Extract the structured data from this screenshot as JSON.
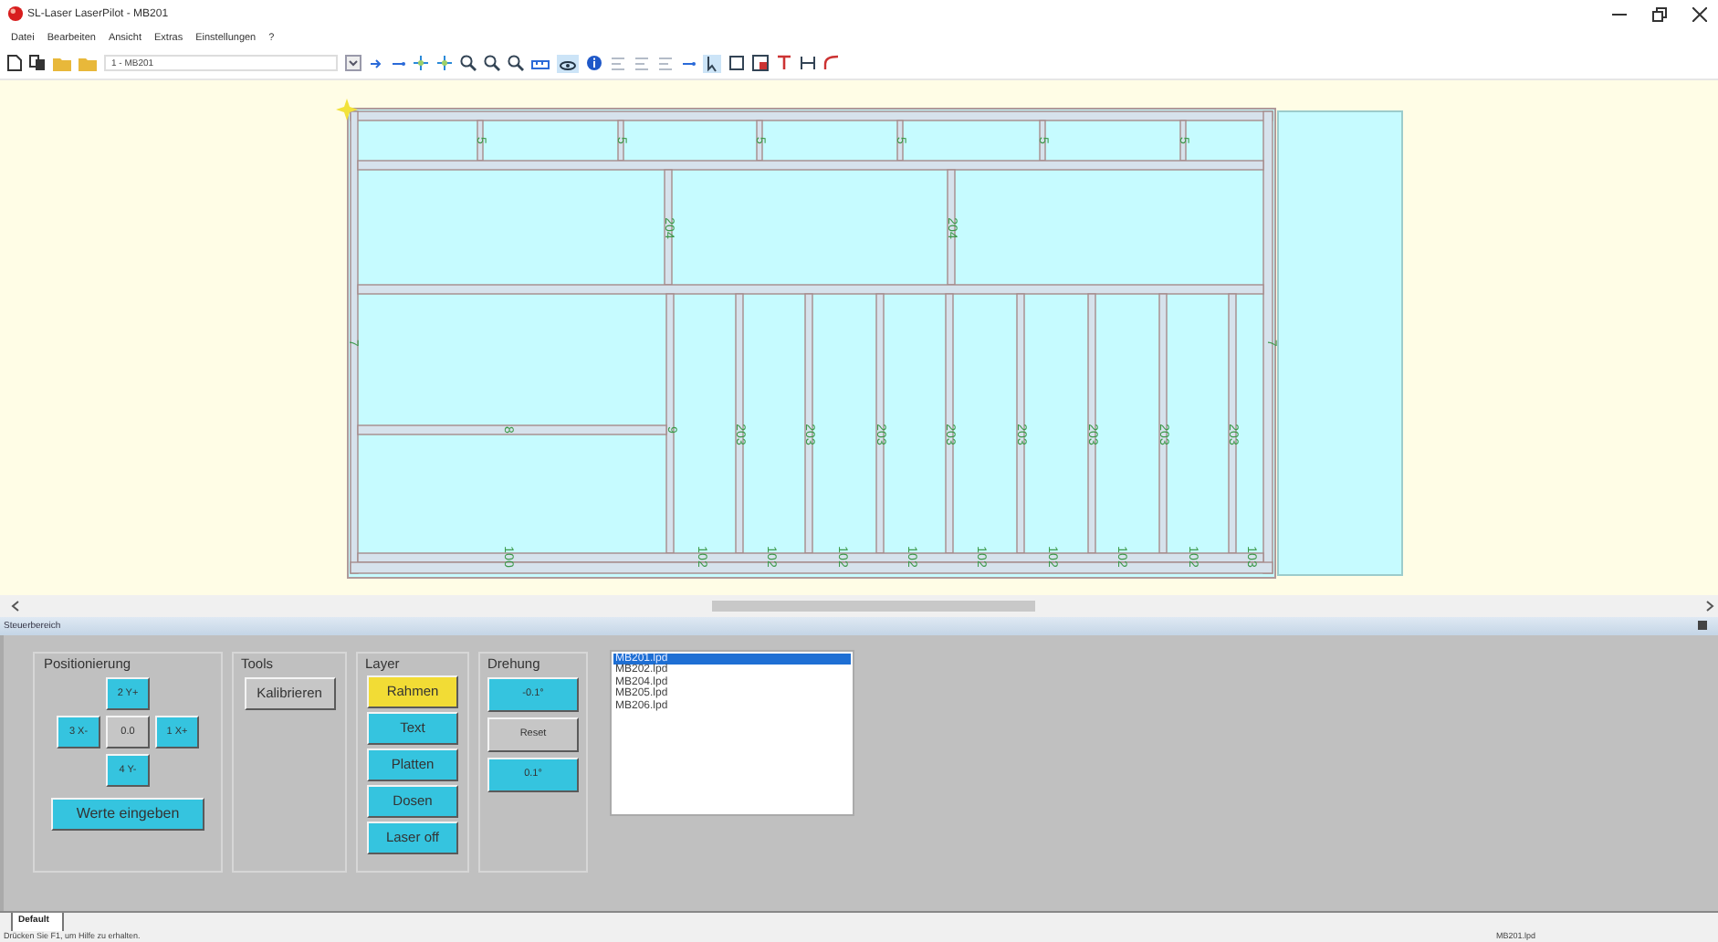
{
  "window": {
    "title": "SL-Laser LaserPilot - MB201"
  },
  "menu": [
    "Datei",
    "Bearbeiten",
    "Ansicht",
    "Extras",
    "Einstellungen",
    "?"
  ],
  "toolbar": {
    "combo_value": "1 - MB201"
  },
  "drawing": {
    "top_labels": [
      "5",
      "5",
      "5",
      "5",
      "5",
      "5"
    ],
    "side_labels": [
      "7",
      "7"
    ],
    "upper_labels": [
      "204",
      "204"
    ],
    "sill_label": "8",
    "joint_label": "9",
    "stud_labels": [
      "203",
      "203",
      "203",
      "203",
      "203",
      "203",
      "203",
      "203"
    ],
    "bottom_labels": [
      "100",
      "102",
      "102",
      "102",
      "102",
      "102",
      "102",
      "102",
      "102",
      "103"
    ]
  },
  "panel": {
    "title": "Steuerbereich",
    "positioning": {
      "title": "Positionierung",
      "buttons": [
        {
          "label": "2 Y+",
          "kind": "move"
        },
        {
          "label": "3 X-",
          "kind": "move"
        },
        {
          "label": "0.0",
          "kind": "value"
        },
        {
          "label": "1 X+",
          "kind": "move"
        },
        {
          "label": "4 Y-",
          "kind": "move"
        }
      ],
      "enter_button": "Werte eingeben"
    },
    "tools": {
      "title": "Tools",
      "buttons": [
        "Kalibrieren"
      ]
    },
    "layer": {
      "title": "Layer",
      "buttons": [
        {
          "label": "Rahmen",
          "selected": true
        },
        {
          "label": "Text",
          "selected": false
        },
        {
          "label": "Platten",
          "selected": false
        },
        {
          "label": "Dosen",
          "selected": false
        },
        {
          "label": "Laser off",
          "selected": false
        }
      ]
    },
    "rotation": {
      "title": "Drehung",
      "buttons": [
        {
          "label": "-0.1°",
          "kind": "rotate"
        },
        {
          "label": "Reset",
          "kind": "reset"
        },
        {
          "label": "0.1°",
          "kind": "rotate"
        }
      ]
    },
    "files": [
      {
        "name": "MB201.lpd",
        "selected": true
      },
      {
        "name": "MB202.lpd",
        "selected": false
      },
      {
        "name": "MB204.lpd",
        "selected": false
      },
      {
        "name": "MB205.lpd",
        "selected": false
      },
      {
        "name": "MB206.lpd",
        "selected": false
      }
    ]
  },
  "tabs": [
    {
      "label": "Default",
      "selected": true
    }
  ],
  "status_bar": {
    "message": "Drücken Sie F1, um Hilfe zu erhalten.",
    "file": "MB201.lpd"
  }
}
